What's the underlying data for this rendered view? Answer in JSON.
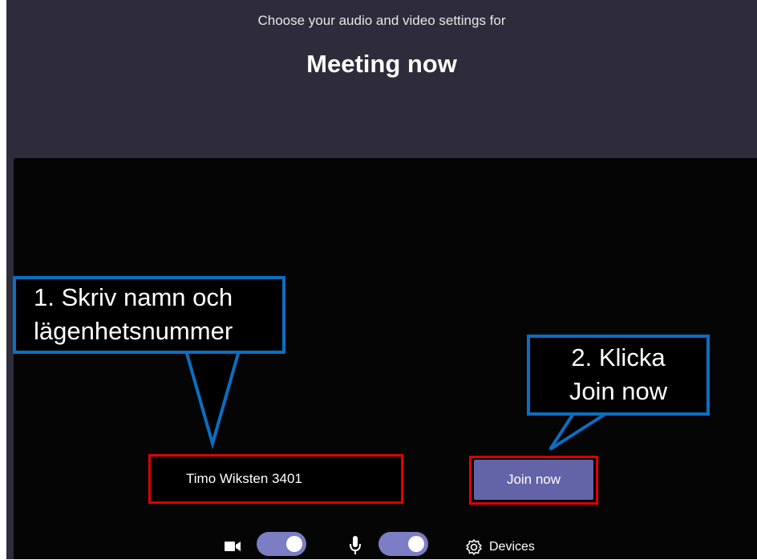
{
  "header": {
    "subtitle": "Choose your audio and video settings for",
    "meeting_title": "Meeting now"
  },
  "name_field": {
    "value": "Timo Wiksten 3401"
  },
  "join_button": {
    "label": "Join now"
  },
  "annotations": {
    "step1_line1": "1. Skriv namn och",
    "step1_line2": "lägenhetsnummer",
    "step2_line1": "2. Klicka",
    "step2_line2": "Join now"
  },
  "controls": {
    "camera_toggle_on": true,
    "mic_toggle_on": true,
    "devices_label": "Devices",
    "icons": [
      "camera-icon",
      "microphone-icon",
      "gear-icon"
    ]
  },
  "colors": {
    "background": "#2e2c3b",
    "video_area": "#050505",
    "accent": "#6264a7",
    "toggle": "#7b7ec4",
    "highlight_red": "#e00000",
    "callout_blue": "#0a6fc2"
  }
}
